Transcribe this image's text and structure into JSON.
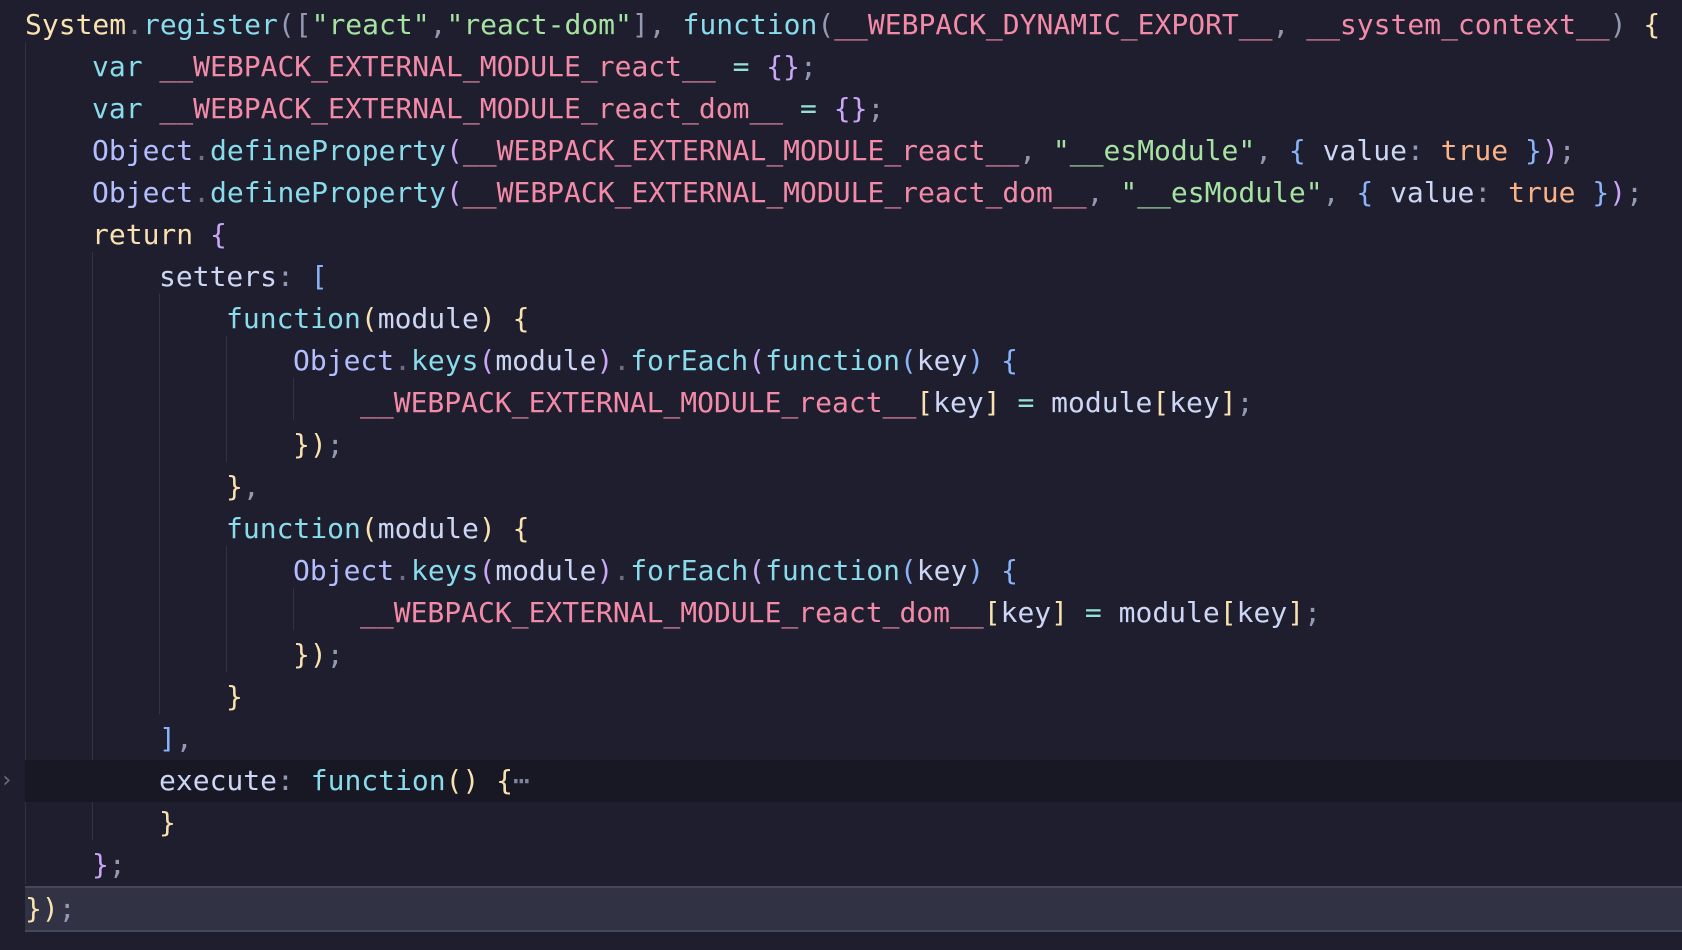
{
  "editor": {
    "colors": {
      "background": "#1e1e2e",
      "current_line": "#313244",
      "fold_line": "#181825"
    },
    "fold_icon": "chevron-right-icon",
    "lines": [
      [
        "System",
        ".",
        "register",
        "([",
        "\"react\"",
        ",",
        "\"react-dom\"",
        "]",
        ",",
        " function",
        "(",
        "__WEBPACK_DYNAMIC_EXPORT__",
        ",",
        " __system_context__",
        ")",
        " {"
      ],
      [
        "var",
        " __WEBPACK_EXTERNAL_MODULE_react__",
        " =",
        " {}",
        ";"
      ],
      [
        "var",
        " __WEBPACK_EXTERNAL_MODULE_react_dom__",
        " =",
        " {}",
        ";"
      ],
      [
        "Object",
        ".",
        "defineProperty",
        "(",
        "__WEBPACK_EXTERNAL_MODULE_react__",
        ",",
        " \"__esModule\"",
        ",",
        " {",
        " value",
        ":",
        " true",
        " }",
        ")",
        ";"
      ],
      [
        "Object",
        ".",
        "defineProperty",
        "(",
        "__WEBPACK_EXTERNAL_MODULE_react_dom__",
        ",",
        " \"__esModule\"",
        ",",
        " {",
        " value",
        ":",
        " true",
        " }",
        ")",
        ";"
      ],
      [
        "return",
        " {"
      ],
      [
        "setters",
        ":",
        " ["
      ],
      [
        "function",
        "(",
        "module",
        ")",
        " {"
      ],
      [
        "Object",
        ".",
        "keys",
        "(",
        "module",
        ")",
        ".",
        "forEach",
        "(",
        "function",
        "(",
        "key",
        ")",
        " {"
      ],
      [
        "__WEBPACK_EXTERNAL_MODULE_react__",
        "[",
        "key",
        "]",
        " =",
        " module",
        "[",
        "key",
        "]",
        ";"
      ],
      [
        "})",
        ";"
      ],
      [
        "}",
        ","
      ],
      [
        "function",
        "(",
        "module",
        ")",
        " {"
      ],
      [
        "Object",
        ".",
        "keys",
        "(",
        "module",
        ")",
        ".",
        "forEach",
        "(",
        "function",
        "(",
        "key",
        ")",
        " {"
      ],
      [
        "__WEBPACK_EXTERNAL_MODULE_react_dom__",
        "[",
        "key",
        "]",
        " =",
        " module",
        "[",
        "key",
        "]",
        ";"
      ],
      [
        "})",
        ";"
      ],
      [
        "}"
      ],
      [
        "]",
        ","
      ],
      [
        "execute",
        ":",
        " function",
        "()",
        " {",
        "⋯"
      ],
      [
        "}"
      ],
      [
        "}",
        ";"
      ],
      [
        "})",
        ";"
      ]
    ]
  }
}
